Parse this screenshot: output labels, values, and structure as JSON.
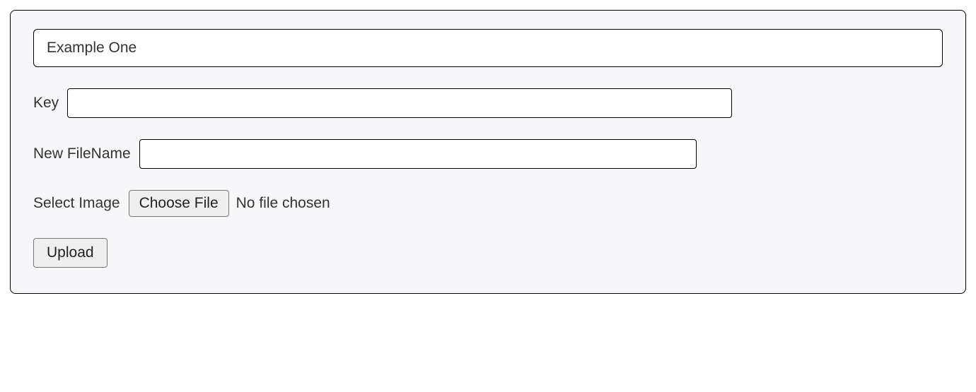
{
  "panel": {
    "legend": "Example One"
  },
  "form": {
    "key_label": "Key",
    "key_value": "",
    "filename_label": "New FileName",
    "filename_value": "",
    "select_image_label": "Select Image",
    "choose_file_label": "Choose File",
    "no_file_chosen": "No file chosen",
    "upload_label": "Upload"
  }
}
